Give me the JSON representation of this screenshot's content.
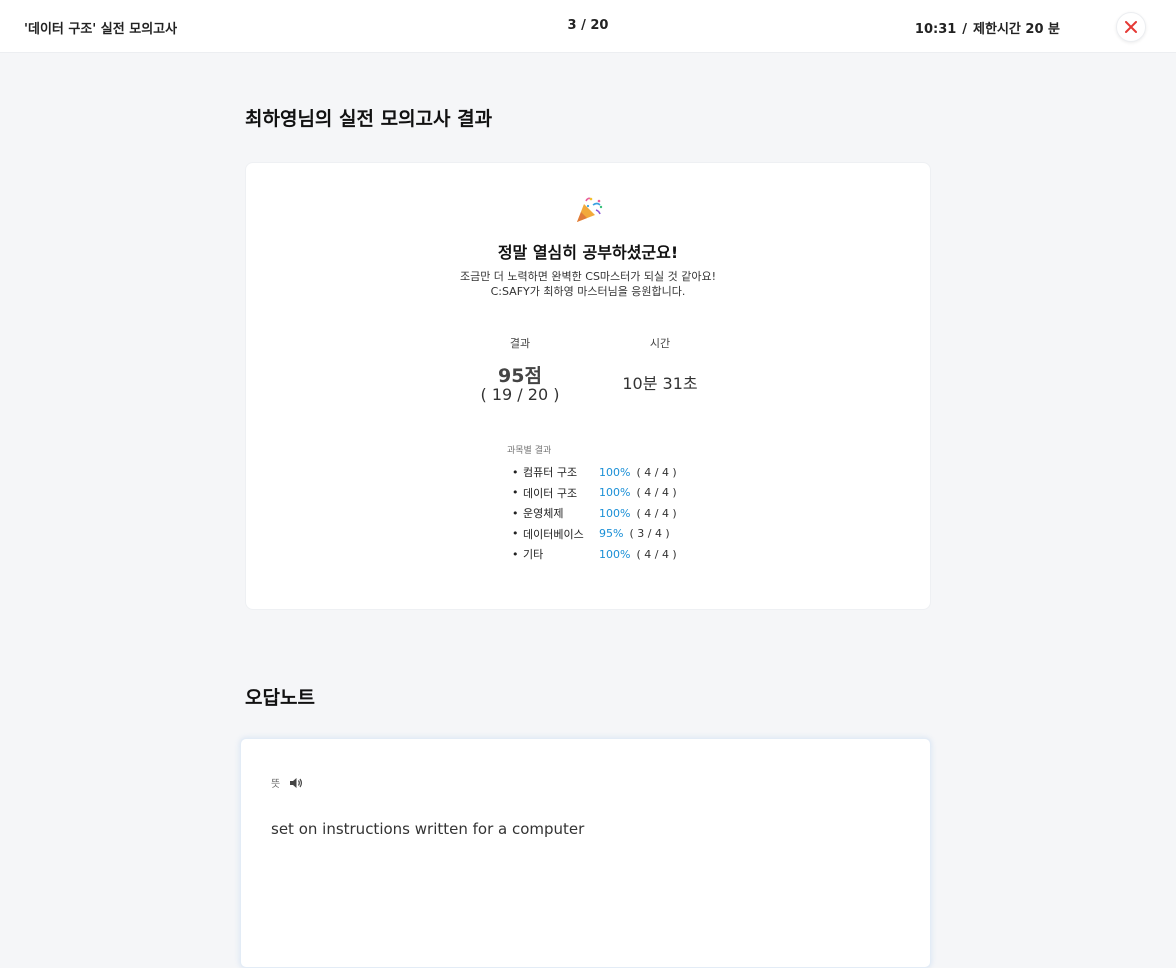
{
  "topbar": {
    "title": "'데이터 구조' 실전 모의고사",
    "progress": "3 / 20",
    "elapsed": "10:31",
    "separator": "/",
    "limit": "제한시간 20 분"
  },
  "result": {
    "heading": "최하영님의 실전 모의고사 결과",
    "headline": "정말 열심히 공부하셨군요!",
    "line1": "조금만 더 노력하면 완벽한 CS마스터가 되실 것 같아요!",
    "line2": "C:SAFY가 최하영 마스터님을 응원합니다.",
    "score_label": "결과",
    "score": "95점",
    "score_fraction": "( 19 / 20 )",
    "time_label": "시간",
    "time": "10분 31초",
    "subjects_label": "과목별 결과",
    "subjects": [
      {
        "name": "컴퓨터 구조",
        "percent": "100%",
        "count": "( 4 / 4 )"
      },
      {
        "name": "데이터 구조",
        "percent": "100%",
        "count": "( 4 / 4 )"
      },
      {
        "name": "운영체제",
        "percent": "100%",
        "count": "( 4 / 4 )"
      },
      {
        "name": "데이터베이스",
        "percent": "95%",
        "count": "( 3 / 4 )"
      },
      {
        "name": "기타",
        "percent": "100%",
        "count": "( 4 / 4 )"
      }
    ]
  },
  "wrong_notes": {
    "heading": "오답노트",
    "label": "뜻",
    "text": "set on instructions written for a computer"
  },
  "colors": {
    "accent": "#1a8fd6",
    "close": "#e53935",
    "background": "#f5f6f8"
  },
  "icons": {
    "close": "close-icon",
    "party": "party-popper-icon",
    "speaker": "speaker-icon"
  }
}
